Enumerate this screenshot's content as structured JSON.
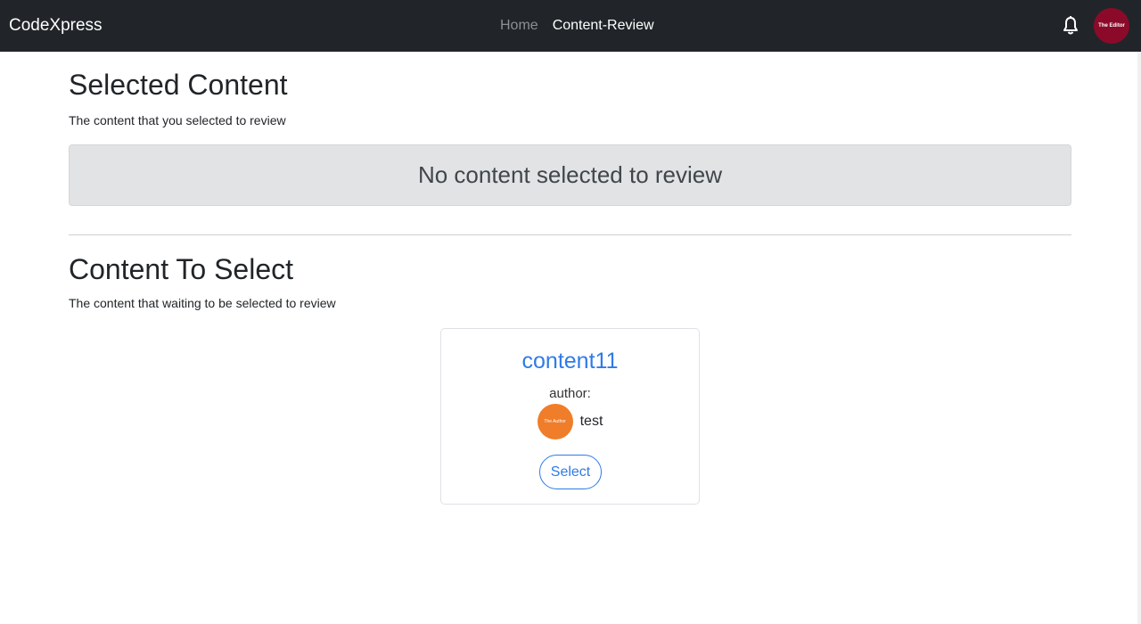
{
  "navbar": {
    "brand": "CodeXpress",
    "links": [
      {
        "label": "Home"
      },
      {
        "label": "Content-Review"
      }
    ],
    "bell_icon": "bell-icon",
    "avatar_text": "The Editor",
    "avatar_color": "#8b0a2a"
  },
  "selected": {
    "title": "Selected Content",
    "subtitle": "The content that you selected to review",
    "empty_message": "No content selected to review"
  },
  "to_select": {
    "title": "Content To Select",
    "subtitle": "The content that waiting to be selected to review",
    "cards": [
      {
        "title": "content11",
        "author_label": "author:",
        "author_avatar_text": "The Author",
        "author_name": "test",
        "button_label": "Select"
      }
    ]
  },
  "colors": {
    "navbar_bg": "#212529",
    "accent": "#2f7be6",
    "author_avatar": "#f07d29"
  }
}
